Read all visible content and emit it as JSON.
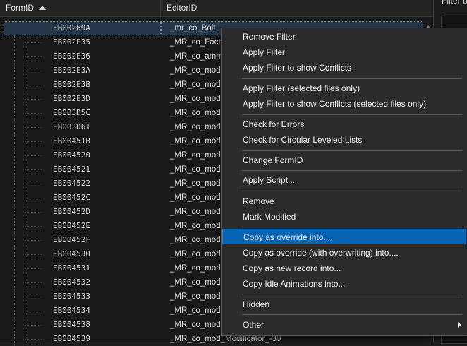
{
  "header": {
    "formid": "FormID",
    "editorid": "EditorID"
  },
  "right_panel": {
    "label": "Filter b"
  },
  "rows": [
    {
      "formid": "EB00269A",
      "editorid": "_mr_co_Bolt"
    },
    {
      "formid": "EB002E35",
      "editorid": "_MR_co_Factor"
    },
    {
      "formid": "EB002E36",
      "editorid": "_MR_co_ammo"
    },
    {
      "formid": "EB002E3A",
      "editorid": "_MR_co_mod"
    },
    {
      "formid": "EB002E3B",
      "editorid": "_MR_co_mod"
    },
    {
      "formid": "EB002E3D",
      "editorid": "_MR_co_mod"
    },
    {
      "formid": "EB003D5C",
      "editorid": "_MR_co_mod"
    },
    {
      "formid": "EB003D61",
      "editorid": "_MR_co_mod"
    },
    {
      "formid": "EB00451B",
      "editorid": "_MR_co_mod"
    },
    {
      "formid": "EB004520",
      "editorid": "_MR_co_mod"
    },
    {
      "formid": "EB004521",
      "editorid": "_MR_co_mod"
    },
    {
      "formid": "EB004522",
      "editorid": "_MR_co_mod"
    },
    {
      "formid": "EB00452C",
      "editorid": "_MR_co_mod"
    },
    {
      "formid": "EB00452D",
      "editorid": "_MR_co_mod"
    },
    {
      "formid": "EB00452E",
      "editorid": "_MR_co_mod"
    },
    {
      "formid": "EB00452F",
      "editorid": "_MR_co_mod"
    },
    {
      "formid": "EB004530",
      "editorid": "_MR_co_mod"
    },
    {
      "formid": "EB004531",
      "editorid": "_MR_co_mod"
    },
    {
      "formid": "EB004532",
      "editorid": "_MR_co_mod"
    },
    {
      "formid": "EB004533",
      "editorid": "_MR_co_mod"
    },
    {
      "formid": "EB004534",
      "editorid": "_MR_co_mod"
    },
    {
      "formid": "EB004538",
      "editorid": "_MR_co_mod"
    },
    {
      "formid": "EB004539",
      "editorid": "_MR_co_mod_Modificator_-30"
    }
  ],
  "menu": {
    "items": [
      "Remove Filter",
      "Apply Filter",
      "Apply Filter to show Conflicts",
      "Apply Filter (selected files only)",
      "Apply Filter to show Conflicts (selected files only)",
      "Check for Errors",
      "Check for Circular Leveled Lists",
      "Change FormID",
      "Apply Script...",
      "Remove",
      "Mark Modified",
      "Copy as override into....",
      "Copy as override (with overwriting) into....",
      "Copy as new record into...",
      "Copy Idle Animations into...",
      "Hidden",
      "Other"
    ],
    "highlighted": "Copy as override into....",
    "highlight_color": "#0a64b4"
  },
  "colors": {
    "background": "#191919",
    "selected_row": "#26364b"
  }
}
